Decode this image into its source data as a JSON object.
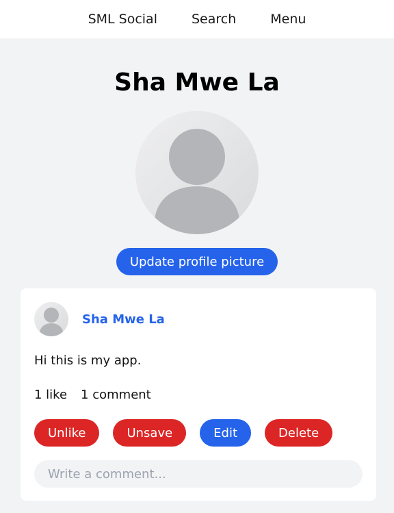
{
  "nav": {
    "brand": "SML Social",
    "search": "Search",
    "menu": "Menu"
  },
  "profile": {
    "name": "Sha Mwe La",
    "update_button": "Update profile picture"
  },
  "post": {
    "author": "Sha Mwe La",
    "text": "Hi this is my app.",
    "likes": "1 like",
    "comments": "1 comment",
    "actions": {
      "unlike": "Unlike",
      "unsave": "Unsave",
      "edit": "Edit",
      "delete": "Delete"
    },
    "comment_placeholder": "Write a comment..."
  },
  "icons": {
    "avatar": "default-user-avatar-icon"
  },
  "colors": {
    "accent": "#2563eb",
    "danger": "#dc2626",
    "background": "#f2f3f5"
  }
}
